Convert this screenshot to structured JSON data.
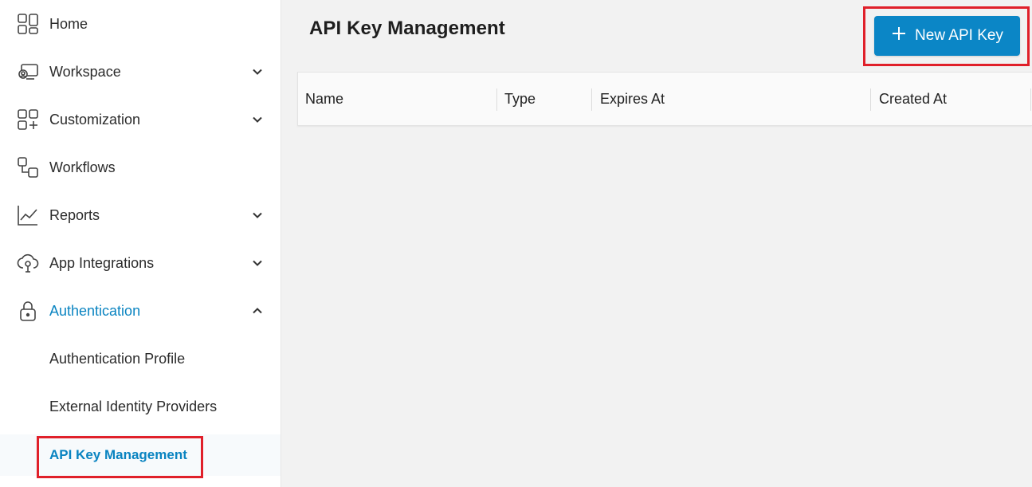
{
  "sidebar": {
    "items": [
      {
        "label": "Home",
        "icon": "home-grid-icon",
        "expandable": false
      },
      {
        "label": "Workspace",
        "icon": "workspace-icon",
        "expandable": true
      },
      {
        "label": "Customization",
        "icon": "customization-icon",
        "expandable": true
      },
      {
        "label": "Workflows",
        "icon": "workflows-icon",
        "expandable": false
      },
      {
        "label": "Reports",
        "icon": "reports-chart-icon",
        "expandable": true
      },
      {
        "label": "App Integrations",
        "icon": "app-integrations-icon",
        "expandable": true
      },
      {
        "label": "Authentication",
        "icon": "lock-icon",
        "expandable": true,
        "expanded": true
      }
    ],
    "sub_items": [
      {
        "label": "Authentication Profile"
      },
      {
        "label": "External Identity Providers"
      },
      {
        "label": "API Key Management",
        "selected": true
      }
    ]
  },
  "main": {
    "title": "API Key Management",
    "new_button_label": "New API Key",
    "table": {
      "columns": [
        "Name",
        "Type",
        "Expires At",
        "Created At"
      ],
      "rows": []
    }
  },
  "colors": {
    "accent": "#0a84c1",
    "button": "#0b86c6",
    "highlight": "#e0202a"
  }
}
